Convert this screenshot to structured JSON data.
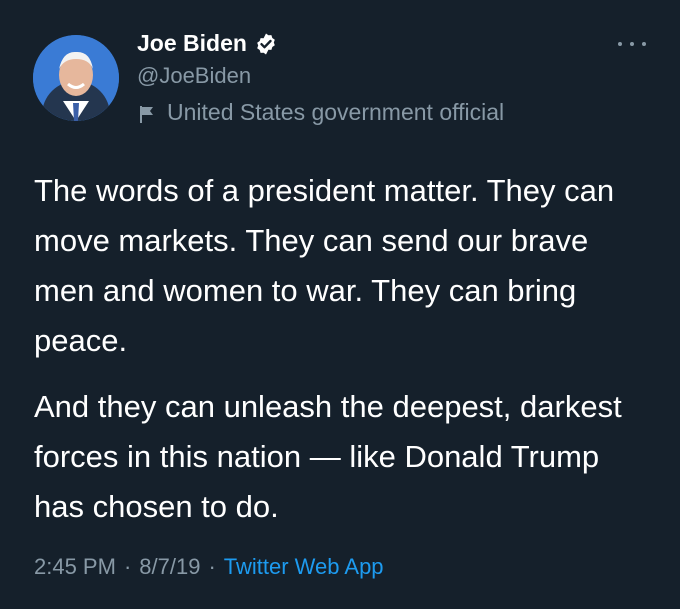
{
  "author": {
    "display_name": "Joe Biden",
    "handle": "@JoeBiden",
    "verified": true,
    "label": "United States government official",
    "avatar_icon": "profile-photo",
    "label_icon": "flag-icon"
  },
  "tweet": {
    "paragraphs": [
      "The words of a president matter. They can move markets. They can send our brave men and women to war. They can bring peace.",
      "And they can unleash the deepest, darkest forces in this nation — like Donald Trump has chosen to do."
    ],
    "time": "2:45 PM",
    "date": "8/7/19",
    "separator": "·",
    "source": "Twitter Web App"
  },
  "colors": {
    "background": "#15202b",
    "text": "#ffffff",
    "muted": "#8899a6",
    "link": "#1d9bf0"
  }
}
